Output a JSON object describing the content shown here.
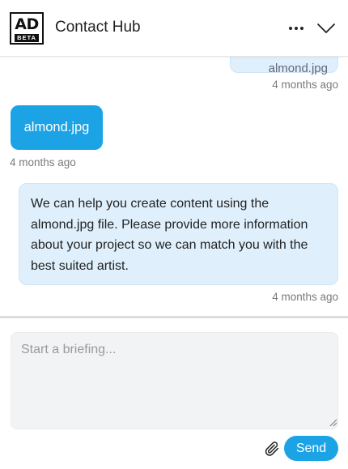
{
  "header": {
    "logo_main": "AD",
    "logo_sub": "BETA",
    "title": "Contact Hub",
    "more_icon": "more-horizontal-icon",
    "collapse_icon": "chevron-down-icon"
  },
  "messages": [
    {
      "side": "right",
      "text": "almond.jpg",
      "timestamp": "4 months ago"
    },
    {
      "side": "left",
      "type": "file",
      "text": "almond.jpg",
      "timestamp": "4 months ago"
    },
    {
      "side": "right",
      "text": "We can help you create content using the almond.jpg file. Please provide more information about your project so we can match you with the best suited artist.",
      "timestamp": "4 months ago"
    }
  ],
  "composer": {
    "placeholder": "Start a briefing...",
    "value": ""
  },
  "actions": {
    "attach_icon": "paperclip-icon",
    "send_label": "Send"
  },
  "colors": {
    "accent": "#1ca3e6",
    "bubble_right": "#dff0fc",
    "input_bg": "#f2f3f4"
  }
}
